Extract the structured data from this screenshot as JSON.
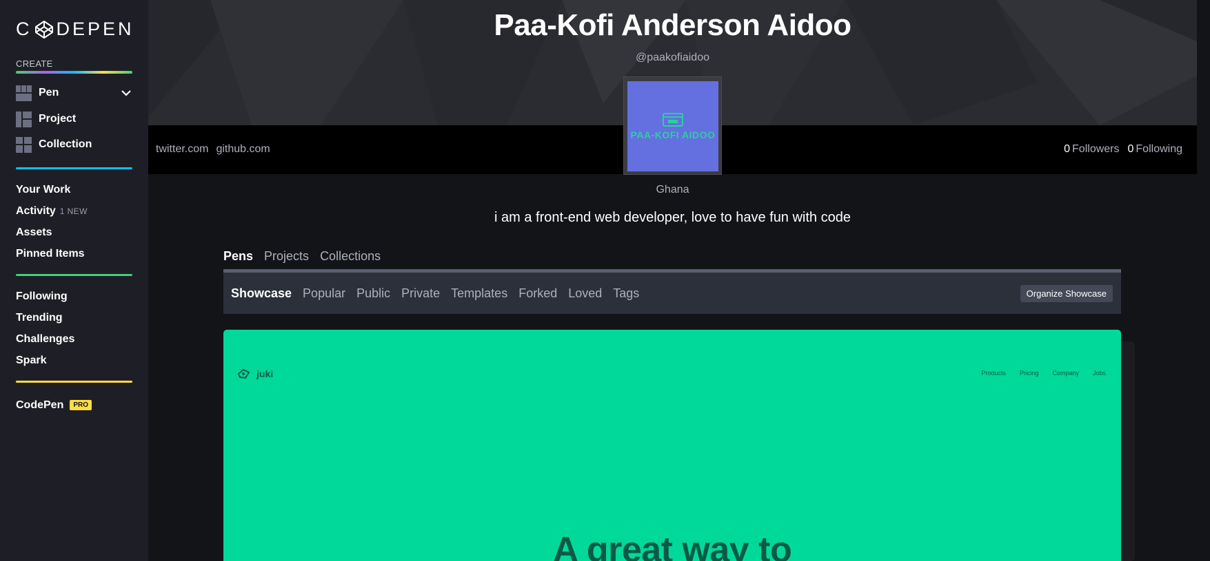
{
  "sidebar": {
    "logo": "CODEPEN",
    "create_label": "CREATE",
    "create_items": [
      {
        "label": "Pen"
      },
      {
        "label": "Project"
      },
      {
        "label": "Collection"
      }
    ],
    "nav_group_1": [
      {
        "label": "Your Work"
      },
      {
        "label": "Activity",
        "badge": "1 NEW"
      },
      {
        "label": "Assets"
      },
      {
        "label": "Pinned Items"
      }
    ],
    "nav_group_2": [
      {
        "label": "Following"
      },
      {
        "label": "Trending"
      },
      {
        "label": "Challenges"
      },
      {
        "label": "Spark"
      }
    ],
    "pro": {
      "label": "CodePen",
      "badge": "PRO"
    },
    "colors": {
      "blue": "#0ebeff",
      "green": "#47cf73",
      "yellow": "#ffdd40"
    }
  },
  "profile": {
    "name": "Paa-Kofi Anderson Aidoo",
    "handle": "@paakofiaidoo",
    "avatar_text": "PAA-KOFI AIDOO",
    "links": [
      "twitter.com",
      "github.com"
    ],
    "followers_count": "0",
    "followers_label": "Followers",
    "following_count": "0",
    "following_label": "Following",
    "location": "Ghana",
    "bio": "i am a front-end web developer, love to have fun with code"
  },
  "content_tabs": [
    "Pens",
    "Projects",
    "Collections"
  ],
  "sub_tabs": [
    "Showcase",
    "Popular",
    "Public",
    "Private",
    "Templates",
    "Forked",
    "Loved",
    "Tags"
  ],
  "organize_button": "Organize Showcase",
  "preview": {
    "brand": "juki",
    "nav": [
      "Products",
      "Pricing",
      "Company",
      "Jobs"
    ],
    "headline": "A great way to",
    "bg_color": "#00d99a"
  }
}
